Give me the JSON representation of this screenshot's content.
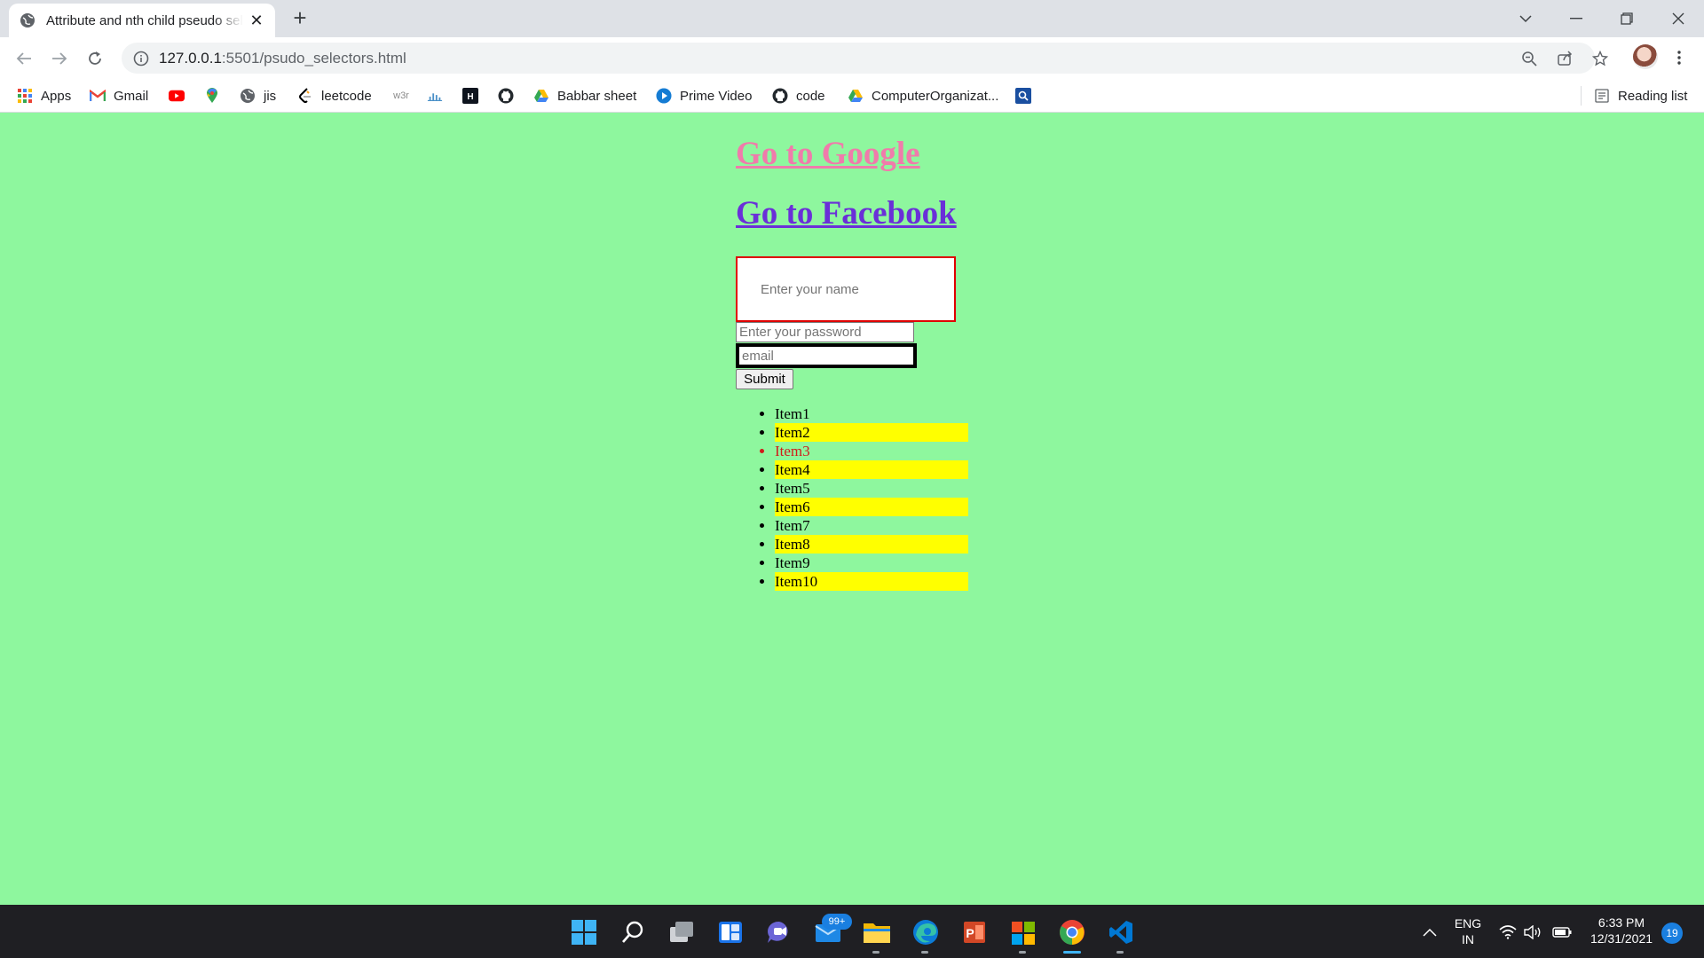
{
  "browser": {
    "tab_title": "Attribute and nth child pseudo selectors",
    "url_host": "127.0.0.1",
    "url_rest": ":5501/psudo_selectors.html"
  },
  "bookmarks": [
    {
      "label": "Apps",
      "icon": "apps-grid-icon"
    },
    {
      "label": "Gmail",
      "icon": "gmail-icon"
    },
    {
      "label": "",
      "icon": "youtube-icon"
    },
    {
      "label": "",
      "icon": "maps-pin-icon"
    },
    {
      "label": "jis",
      "icon": "globe-icon"
    },
    {
      "label": "leetcode",
      "icon": "leetcode-icon"
    },
    {
      "label": "",
      "icon": "w3schools-icon"
    },
    {
      "label": "",
      "icon": "chart-icon"
    },
    {
      "label": "",
      "icon": "hackerrank-icon"
    },
    {
      "label": "",
      "icon": "github-icon"
    },
    {
      "label": "Babbar sheet",
      "icon": "drive-icon"
    },
    {
      "label": "Prime Video",
      "icon": "prime-video-icon"
    },
    {
      "label": "code",
      "icon": "github-icon"
    },
    {
      "label": "ComputerOrganizat...",
      "icon": "drive-icon"
    },
    {
      "label": "",
      "icon": "search-box-icon"
    }
  ],
  "reading_list": "Reading list",
  "page": {
    "link_google": "Go to Google",
    "link_facebook": "Go to Facebook",
    "name_placeholder": "Enter your name",
    "password_placeholder": "Enter your password",
    "email_placeholder": "email",
    "submit_label": "Submit",
    "items": [
      "Item1",
      "Item2",
      "Item3",
      "Item4",
      "Item5",
      "Item6",
      "Item7",
      "Item8",
      "Item9",
      "Item10"
    ]
  },
  "colors": {
    "page_background": "#8ef79e",
    "google_link": "#f07bab",
    "facebook_link": "#6a2fd8",
    "even_item_highlight": "#ffff00",
    "item3_text": "#d11b1b",
    "name_input_border": "#e00000"
  },
  "taskbar": {
    "mail_badge": "99+",
    "lang_line1": "ENG",
    "lang_line2": "IN",
    "time": "6:33 PM",
    "date": "12/31/2021",
    "notifications": "19"
  }
}
